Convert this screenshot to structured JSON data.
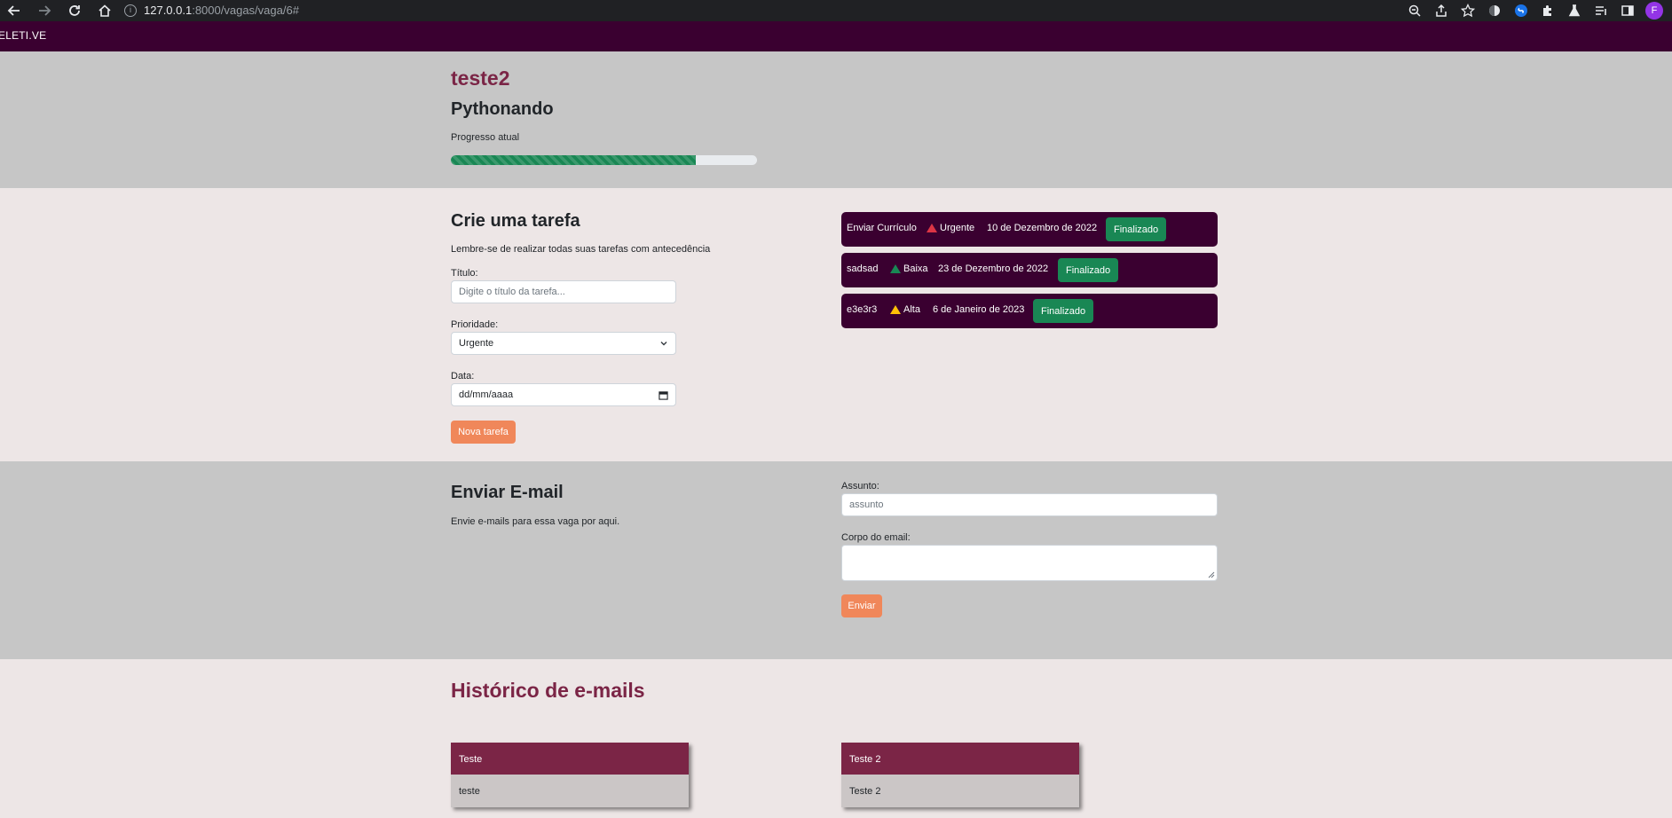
{
  "browser": {
    "url_host": "127.0.0.1",
    "url_path": ":8000/vagas/vaga/6#",
    "profile_initial": "F"
  },
  "navbar": {
    "brand": "ELETI.VE"
  },
  "header": {
    "job_title": "teste2",
    "company": "Pythonando",
    "progress_label": "Progresso atual",
    "progress_percent": 80
  },
  "task_form": {
    "heading": "Crie uma tarefa",
    "hint": "Lembre-se de realizar todas suas tarefas com antecedência",
    "title_label": "Título:",
    "title_placeholder": "Digite o título da tarefa...",
    "priority_label": "Prioridade:",
    "priority_value": "Urgente",
    "date_label": "Data:",
    "date_value": "dd/mm/aaaa",
    "submit_label": "Nova tarefa"
  },
  "tasks": [
    {
      "title": "Enviar Currículo",
      "priority": "Urgente",
      "priority_color": "#dc3545",
      "date": "10 de Dezembro de 2022",
      "status": "Finalizado"
    },
    {
      "title": "sadsad",
      "priority": "Baixa",
      "priority_color": "#198754",
      "date": "23 de Dezembro de 2022",
      "status": "Finalizado"
    },
    {
      "title": "e3e3r3",
      "priority": "Alta",
      "priority_color": "#ffc107",
      "date": "6 de Janeiro de 2023",
      "status": "Finalizado"
    }
  ],
  "email_form": {
    "heading": "Enviar E-mail",
    "hint": "Envie e-mails para essa vaga por aqui.",
    "subject_label": "Assunto:",
    "subject_placeholder": "assunto",
    "body_label": "Corpo do email:",
    "submit_label": "Enviar"
  },
  "history": {
    "heading": "Histórico de e-mails",
    "emails": [
      {
        "subject": "Teste",
        "body": "teste"
      },
      {
        "subject": "Teste 2",
        "body": "Teste 2"
      }
    ]
  },
  "colors": {
    "brand_dark": "#3a0030",
    "accent_wine": "#7b2546",
    "accent_orange": "#f0875a",
    "success": "#198754"
  }
}
